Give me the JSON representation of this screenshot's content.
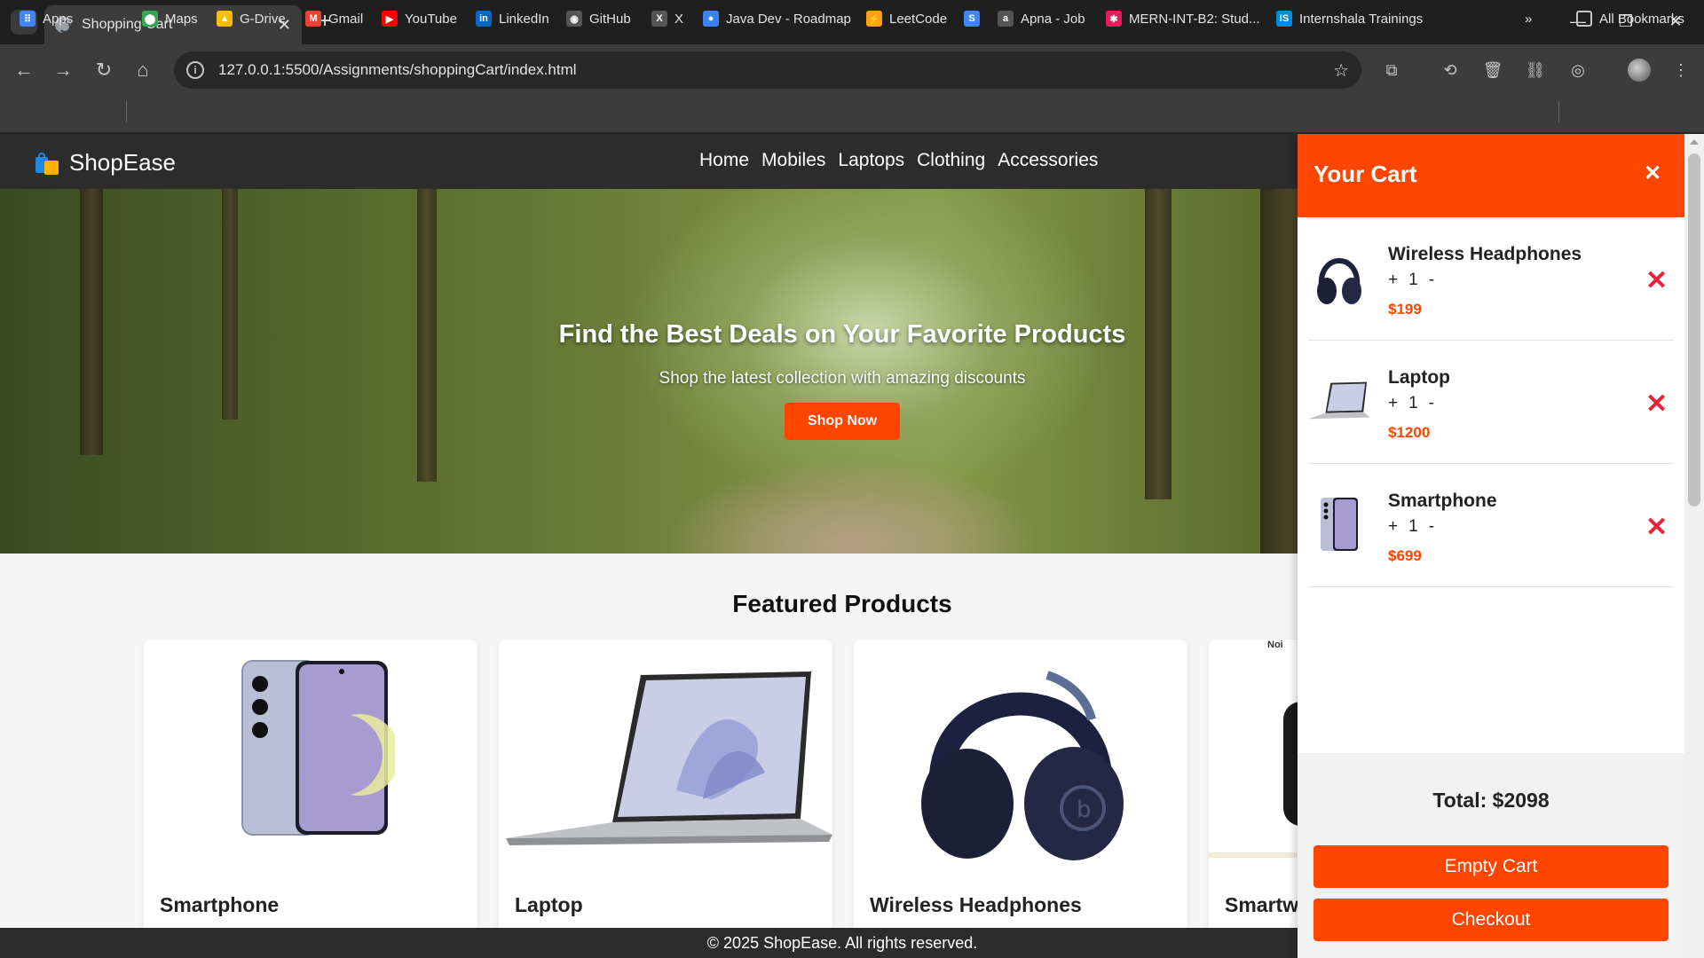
{
  "browser": {
    "tab_title": "Shopping Cart",
    "tab_close": "✕",
    "new_tab": "+",
    "url": "127.0.0.1:5500/Assignments/shoppingCart/index.html",
    "bookmarks": [
      {
        "label": "Apps",
        "icon": "apps-grid-icon",
        "color": "#4285f4"
      },
      {
        "label": "Maps",
        "icon": "maps-icon",
        "color": "#34a853"
      },
      {
        "label": "G-Drive",
        "icon": "drive-icon",
        "color": "#fbbc04"
      },
      {
        "label": "Gmail",
        "icon": "gmail-icon",
        "color": "#ea4335"
      },
      {
        "label": "YouTube",
        "icon": "youtube-icon",
        "color": "#ff0000"
      },
      {
        "label": "LinkedIn",
        "icon": "linkedin-icon",
        "color": "#0a66c2"
      },
      {
        "label": "GitHub",
        "icon": "github-icon",
        "color": "#ffffff"
      },
      {
        "label": "X",
        "icon": "x-icon",
        "color": "#000000"
      },
      {
        "label": "Java Dev - Roadmap",
        "icon": "roadmap-icon",
        "color": "#3b82f6"
      },
      {
        "label": "LeetCode",
        "icon": "leetcode-icon",
        "color": "#ffa116"
      },
      {
        "label": "",
        "icon": "s-badge-icon",
        "color": "#4285f4"
      },
      {
        "label": "Apna - Job",
        "icon": "apna-icon",
        "color": "#ffffff"
      },
      {
        "label": "MERN-INT-B2: Stud...",
        "icon": "slack-icon",
        "color": "#e01e5a"
      },
      {
        "label": "Internshala Trainings",
        "icon": "internshala-icon",
        "color": "#008bdc"
      }
    ],
    "all_bookmarks": "All Bookmarks",
    "more": "»"
  },
  "site": {
    "brand": "ShopEase",
    "nav": [
      "Home",
      "Mobiles",
      "Laptops",
      "Clothing",
      "Accessories"
    ],
    "hero": {
      "title": "Find the Best Deals on Your Favorite Products",
      "subtitle": "Shop the latest collection with amazing discounts",
      "cta": "Shop Now"
    },
    "featured_title": "Featured Products",
    "products": [
      {
        "name": "Smartphone",
        "icon": "smartphone-image"
      },
      {
        "name": "Laptop",
        "icon": "laptop-image"
      },
      {
        "name": "Wireless Headphones",
        "icon": "headphones-image"
      },
      {
        "name": "Smartw",
        "icon": "smartwatch-image",
        "tag": "Noi"
      }
    ],
    "footer": "© 2025 ShopEase. All rights reserved."
  },
  "cart": {
    "title": "Your Cart",
    "close": "✕",
    "items": [
      {
        "name": "Wireless Headphones",
        "plus": "+",
        "qty": "1",
        "minus": "-",
        "price": "$199"
      },
      {
        "name": "Laptop",
        "plus": "+",
        "qty": "1",
        "minus": "-",
        "price": "$1200"
      },
      {
        "name": "Smartphone",
        "plus": "+",
        "qty": "1",
        "minus": "-",
        "price": "$699"
      }
    ],
    "remove_symbol": "✕",
    "total": "Total: $2098",
    "empty_label": "Empty Cart",
    "checkout_label": "Checkout"
  },
  "colors": {
    "accent": "#ff4500",
    "remove": "#ef1f3a",
    "header": "#2c2c2c"
  }
}
